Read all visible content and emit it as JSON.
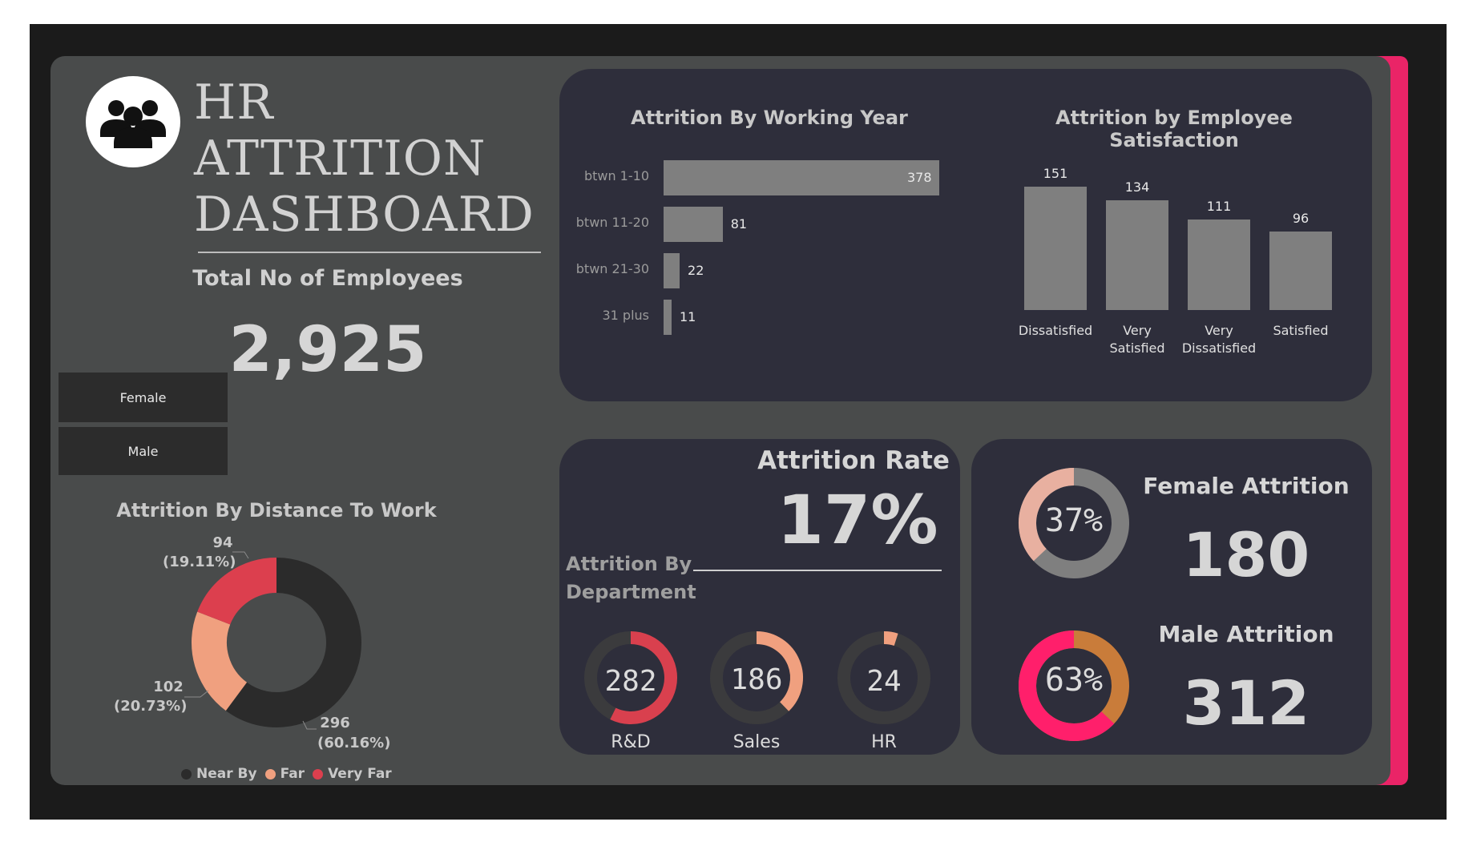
{
  "header": {
    "title_line1": "HR",
    "title_line2": "ATTRITION",
    "title_line3": "DASHBOARD",
    "icon": "group-icon"
  },
  "kpi": {
    "total_label": "Total No of Employees",
    "total_value": "2,925"
  },
  "slicer": {
    "female_label": "Female",
    "male_label": "Male"
  },
  "distance": {
    "title": "Attrition By Distance To Work",
    "legend": [
      "Near By",
      "Far",
      "Very Far"
    ],
    "label_very_far_value": "94",
    "label_very_far_pct": "(19.11%)",
    "label_far_value": "102",
    "label_far_pct": "(20.73%)",
    "label_near_value": "296",
    "label_near_pct": "(60.16%)"
  },
  "working_year": {
    "title": "Attrition By Working Year",
    "bars": [
      {
        "label": "btwn 1-10",
        "value": "378"
      },
      {
        "label": "btwn 11-20",
        "value": "81"
      },
      {
        "label": "btwn 21-30",
        "value": "22"
      },
      {
        "label": "31 plus",
        "value": "11"
      }
    ]
  },
  "satisfaction": {
    "title": "Attrition by Employee Satisfaction",
    "bars": [
      {
        "label_line1": "Dissatisfied",
        "label_line2": "",
        "value": "151"
      },
      {
        "label_line1": "Very",
        "label_line2": "Satisfied",
        "value": "134"
      },
      {
        "label_line1": "Very",
        "label_line2": "Dissatisfied",
        "value": "111"
      },
      {
        "label_line1": "Satisfied",
        "label_line2": "",
        "value": "96"
      }
    ]
  },
  "rate": {
    "title": "Attrition Rate",
    "value": "17%",
    "dept_title_line1": "Attrition By",
    "dept_title_line2": "Department",
    "departments": [
      {
        "name": "R&D",
        "value": "282"
      },
      {
        "name": "Sales",
        "value": "186"
      },
      {
        "name": "HR",
        "value": "24"
      }
    ]
  },
  "gender": {
    "female_title": "Female Attrition",
    "female_value": "180",
    "female_pct": "37%",
    "male_title": "Male Attrition",
    "male_value": "312",
    "male_pct": "63%"
  },
  "chart_data": [
    {
      "type": "bar",
      "title": "Attrition By Working Year",
      "orientation": "horizontal",
      "categories": [
        "btwn 1-10",
        "btwn 11-20",
        "btwn 21-30",
        "31 plus"
      ],
      "values": [
        378,
        81,
        22,
        11
      ],
      "color": "#7f7f7f"
    },
    {
      "type": "bar",
      "title": "Attrition by Employee Satisfaction",
      "categories": [
        "Dissatisfied",
        "Very Satisfied",
        "Very Dissatisfied",
        "Satisfied"
      ],
      "values": [
        151,
        134,
        111,
        96
      ],
      "color": "#7f7f7f"
    },
    {
      "type": "pie",
      "title": "Attrition By Distance To Work",
      "categories": [
        "Near By",
        "Far",
        "Very Far"
      ],
      "values": [
        296,
        102,
        94
      ],
      "percents": [
        60.16,
        20.73,
        19.11
      ],
      "colors": [
        "#2b2b2b",
        "#f0a07f",
        "#dc3f4e"
      ],
      "legend": "bottom"
    },
    {
      "type": "pie",
      "title": "Attrition By Department",
      "categories": [
        "R&D",
        "Sales",
        "HR"
      ],
      "values": [
        282,
        186,
        24
      ],
      "fractions": [
        0.573,
        0.378,
        0.049
      ],
      "colors": [
        "#d9404e",
        "#f0a07f",
        "#f0a07f"
      ],
      "track_color": "#3b3b3d"
    },
    {
      "type": "pie",
      "title": "Female Attrition",
      "values": [
        180
      ],
      "percent": 37,
      "colors": [
        "#e8b0a0",
        "#7f7f7f"
      ]
    },
    {
      "type": "pie",
      "title": "Male Attrition",
      "values": [
        312
      ],
      "percent": 63,
      "colors": [
        "#ff1f6b",
        "#c97c3a"
      ]
    }
  ],
  "colors": {
    "frame": "#1b1b1b",
    "canvas": "#494b4b",
    "panel": "#2e2e3b",
    "accent": "#ea2467",
    "bar": "#7f7f7f"
  }
}
